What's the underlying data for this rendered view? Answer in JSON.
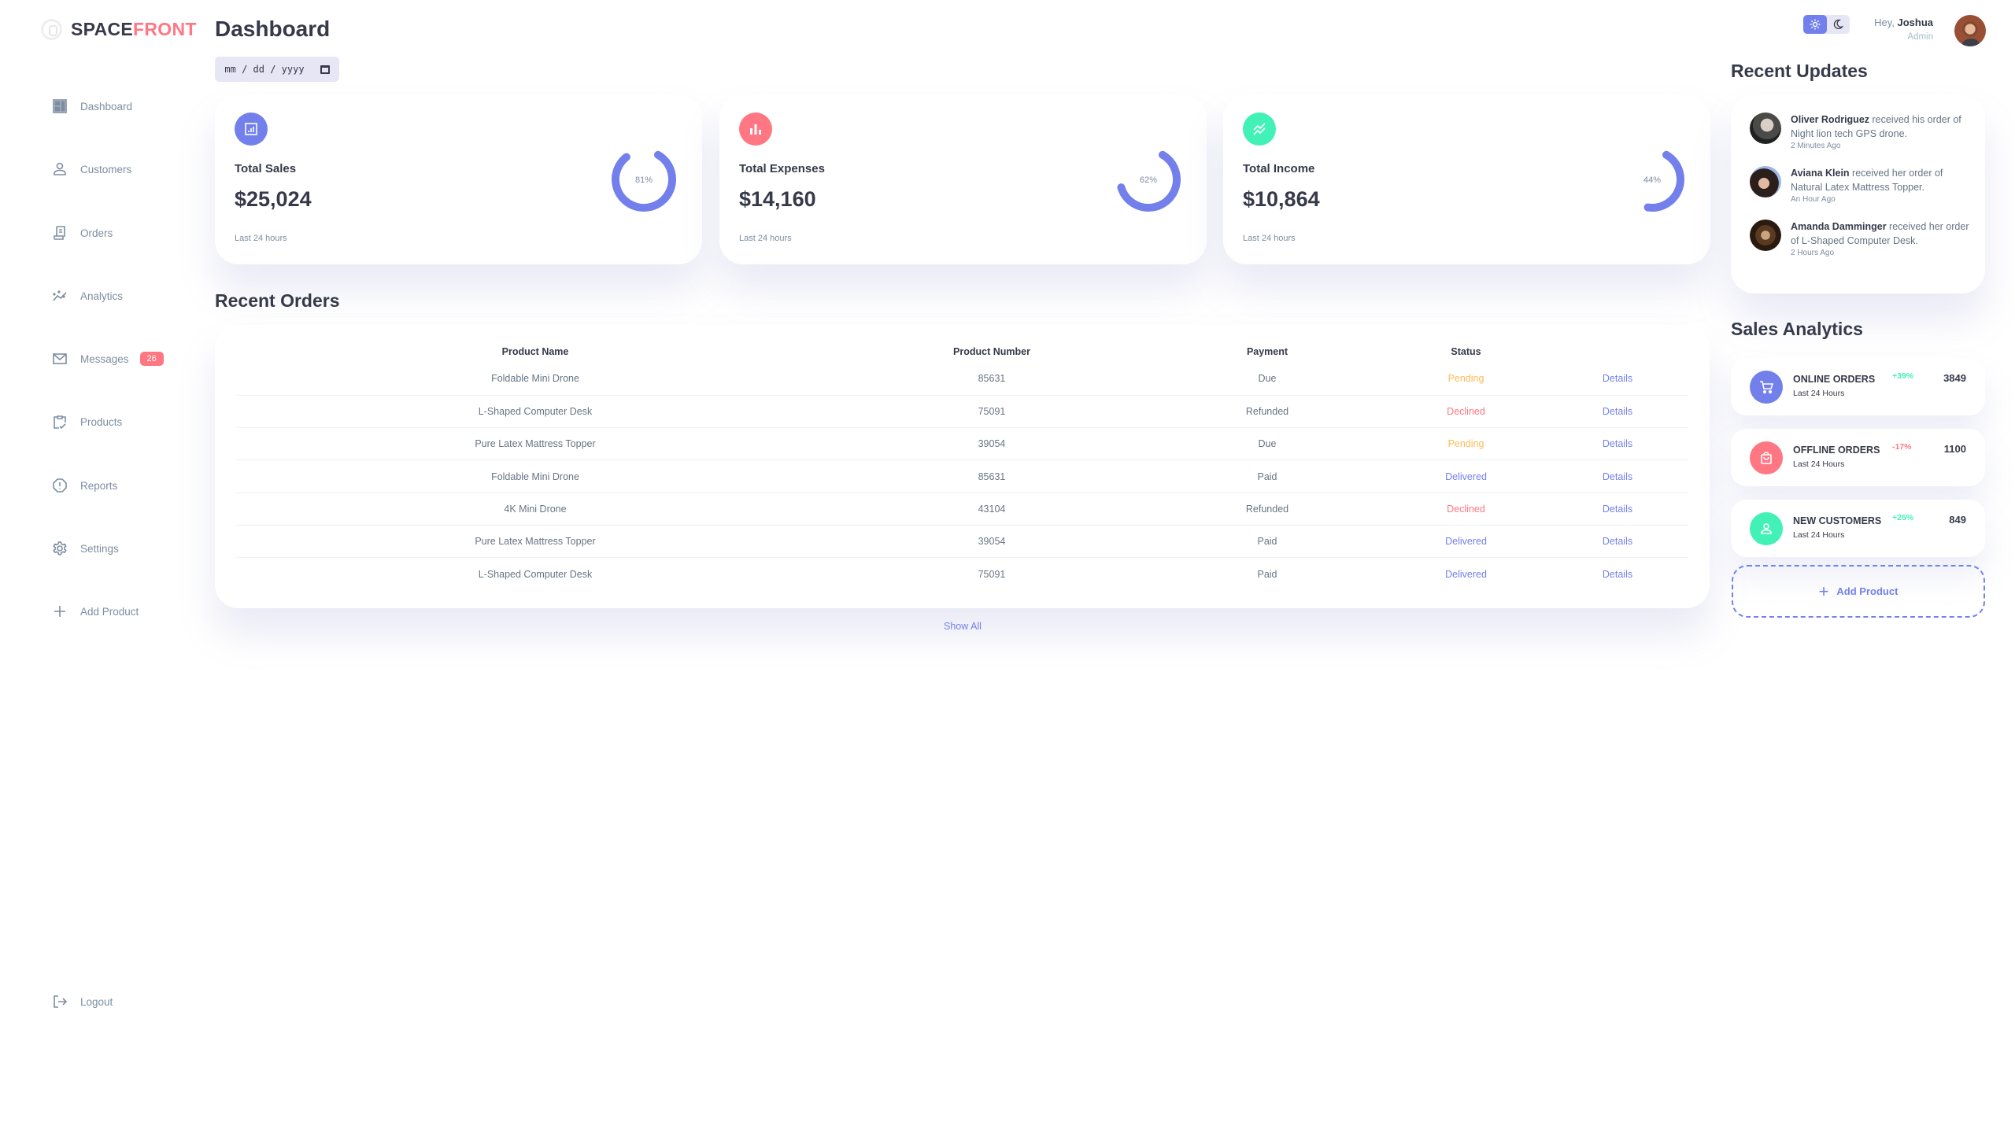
{
  "brand": {
    "part1": "SPACE",
    "part2": "FRONT"
  },
  "colors": {
    "primary": "#7380ec",
    "danger": "#ff7782",
    "success": "#41f1b6",
    "warning": "#ffbb55",
    "dark": "#363949",
    "muted": "#7d8da1"
  },
  "header": {
    "title": "Dashboard",
    "date_placeholder": "mm / dd / yyyy",
    "greeting": "Hey,",
    "user_name": "Joshua",
    "user_role": "Admin",
    "theme": {
      "light_icon": "sun-icon",
      "dark_icon": "moon-icon",
      "active": "light"
    }
  },
  "sidebar": {
    "items": [
      {
        "label": "Dashboard",
        "icon": "grid-view-icon"
      },
      {
        "label": "Customers",
        "icon": "person-icon"
      },
      {
        "label": "Orders",
        "icon": "receipt-icon"
      },
      {
        "label": "Analytics",
        "icon": "insights-icon"
      },
      {
        "label": "Messages",
        "icon": "mail-icon",
        "badge": "26"
      },
      {
        "label": "Products",
        "icon": "inventory-icon"
      },
      {
        "label": "Reports",
        "icon": "report-icon"
      },
      {
        "label": "Settings",
        "icon": "settings-icon"
      },
      {
        "label": "Add Product",
        "icon": "add-icon"
      }
    ],
    "logout": {
      "label": "Logout",
      "icon": "logout-icon"
    }
  },
  "cards": [
    {
      "title": "Total Sales",
      "value": "$25,024",
      "subtitle": "Last 24 hours",
      "percent": 81,
      "percent_label": "81%",
      "icon": "analytics-icon",
      "color": "#7380ec"
    },
    {
      "title": "Total Expenses",
      "value": "$14,160",
      "subtitle": "Last 24 hours",
      "percent": 62,
      "percent_label": "62%",
      "icon": "bar-chart-icon",
      "color": "#ff7782"
    },
    {
      "title": "Total Income",
      "value": "$10,864",
      "subtitle": "Last 24 hours",
      "percent": 44,
      "percent_label": "44%",
      "icon": "stacked-line-chart-icon",
      "color": "#41f1b6"
    }
  ],
  "orders": {
    "title": "Recent Orders",
    "columns": [
      "Product Name",
      "Product Number",
      "Payment",
      "Status",
      ""
    ],
    "rows": [
      {
        "name": "Foldable Mini Drone",
        "number": "85631",
        "payment": "Due",
        "status": "Pending",
        "status_kind": "pending",
        "action": "Details"
      },
      {
        "name": "L-Shaped Computer Desk",
        "number": "75091",
        "payment": "Refunded",
        "status": "Declined",
        "status_kind": "declined",
        "action": "Details"
      },
      {
        "name": "Pure Latex Mattress Topper",
        "number": "39054",
        "payment": "Due",
        "status": "Pending",
        "status_kind": "pending",
        "action": "Details"
      },
      {
        "name": "Foldable Mini Drone",
        "number": "85631",
        "payment": "Paid",
        "status": "Delivered",
        "status_kind": "delivered",
        "action": "Details"
      },
      {
        "name": "4K Mini Drone",
        "number": "43104",
        "payment": "Refunded",
        "status": "Declined",
        "status_kind": "declined",
        "action": "Details"
      },
      {
        "name": "Pure Latex Mattress Topper",
        "number": "39054",
        "payment": "Paid",
        "status": "Delivered",
        "status_kind": "delivered",
        "action": "Details"
      },
      {
        "name": "L-Shaped Computer Desk",
        "number": "75091",
        "payment": "Paid",
        "status": "Delivered",
        "status_kind": "delivered",
        "action": "Details"
      }
    ],
    "show_all": "Show All"
  },
  "updates": {
    "title": "Recent Updates",
    "items": [
      {
        "name": "Oliver Rodriguez",
        "text": " received his order of Night lion tech GPS drone.",
        "time": "2 Minutes Ago"
      },
      {
        "name": "Aviana Klein",
        "text": " received her order of Natural Latex Mattress Topper.",
        "time": "An Hour Ago"
      },
      {
        "name": "Amanda Damminger",
        "text": " received her order of L-Shaped Computer Desk.",
        "time": "2 Hours Ago"
      }
    ]
  },
  "analytics": {
    "title": "Sales Analytics",
    "items": [
      {
        "name": "ONLINE ORDERS",
        "subtitle": "Last 24 Hours",
        "change": "+39%",
        "trend": "up",
        "count": "3849",
        "icon": "shopping-cart-icon",
        "color": "#7380ec"
      },
      {
        "name": "OFFLINE ORDERS",
        "subtitle": "Last 24 Hours",
        "change": "-17%",
        "trend": "down",
        "count": "1100",
        "icon": "local-mall-icon",
        "color": "#ff7782"
      },
      {
        "name": "NEW CUSTOMERS",
        "subtitle": "Last 24 Hours",
        "change": "+25%",
        "trend": "up",
        "count": "849",
        "icon": "person-icon",
        "color": "#41f1b6"
      }
    ],
    "add_product": "Add Product"
  }
}
